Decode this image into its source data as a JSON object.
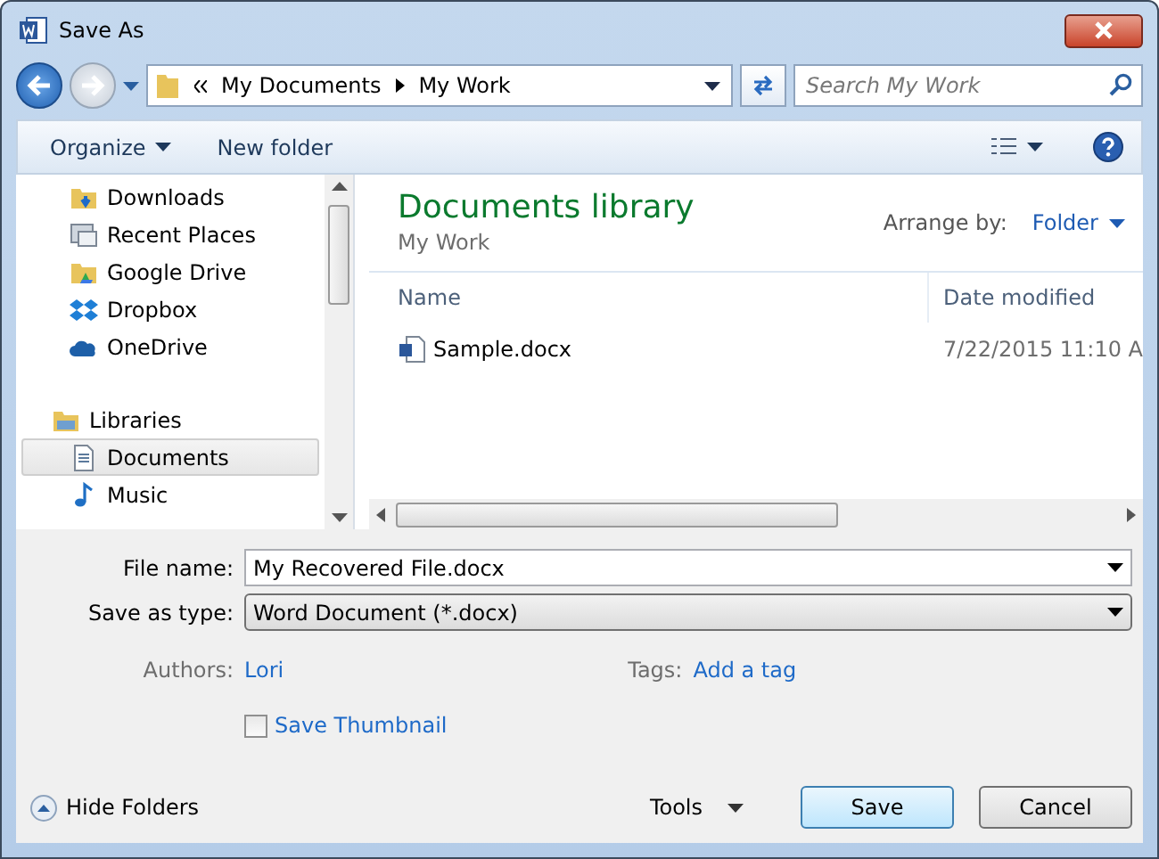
{
  "window": {
    "title": "Save As"
  },
  "nav": {
    "path": [
      "My Documents",
      "My Work"
    ],
    "search": {
      "placeholder": "Search My Work"
    }
  },
  "toolbar": {
    "organize": "Organize",
    "new_folder": "New folder"
  },
  "sidebar": {
    "items": [
      {
        "label": "Downloads",
        "kind": "downloads",
        "selected": false
      },
      {
        "label": "Recent Places",
        "kind": "recent",
        "selected": false
      },
      {
        "label": "Google Drive",
        "kind": "gdrive",
        "selected": false
      },
      {
        "label": "Dropbox",
        "kind": "dropbox",
        "selected": false
      },
      {
        "label": "OneDrive",
        "kind": "onedrive",
        "selected": false
      },
      {
        "label": "Libraries",
        "kind": "libraries",
        "selected": false
      },
      {
        "label": "Documents",
        "kind": "documents",
        "selected": true
      },
      {
        "label": "Music",
        "kind": "music",
        "selected": false
      }
    ]
  },
  "library": {
    "title": "Documents library",
    "subtitle": "My Work",
    "arrange_label": "Arrange by:",
    "arrange_value": "Folder"
  },
  "table": {
    "columns": [
      "Name",
      "Date modified"
    ],
    "rows": [
      {
        "name": "Sample.docx",
        "date": "7/22/2015 11:10 A"
      }
    ]
  },
  "form": {
    "file_name": {
      "label": "File name:",
      "value": "My Recovered File.docx"
    },
    "save_as_type": {
      "label": "Save as type:",
      "value": "Word Document (*.docx)"
    },
    "authors": {
      "label": "Authors:",
      "value": "Lori"
    },
    "tags": {
      "label": "Tags:",
      "value": "Add a tag"
    },
    "save_thumbnail": {
      "label": "Save Thumbnail",
      "checked": false
    }
  },
  "footer": {
    "hide_folders": "Hide Folders",
    "tools": "Tools",
    "buttons": [
      {
        "label": "Save",
        "default": true
      },
      {
        "label": "Cancel",
        "default": false
      }
    ]
  }
}
